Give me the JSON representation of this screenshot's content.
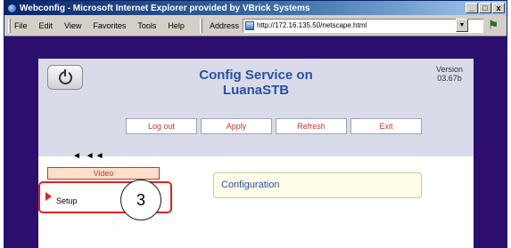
{
  "window": {
    "title": "Webconfig - Microsoft Internet Explorer provided by VBrick Systems",
    "controls": [
      "_",
      "□",
      "x"
    ]
  },
  "menubar": {
    "items": [
      "File",
      "Edit",
      "View",
      "Favorites",
      "Tools",
      "Help"
    ]
  },
  "address": {
    "label": "Address",
    "url": "http://172.16.135.50/netscape.html"
  },
  "page": {
    "title_line1": "Config Service on",
    "title_line2": "LuanaSTB",
    "version_label": "Version",
    "version_value": "03.67b",
    "nav": [
      "Log out",
      "Apply",
      "Refresh",
      "Exit"
    ],
    "arrows": "◄ ◄◄",
    "video_tab": "Video",
    "setup_label": "Setup",
    "callout_number": "3",
    "config_label": "Configuration"
  }
}
